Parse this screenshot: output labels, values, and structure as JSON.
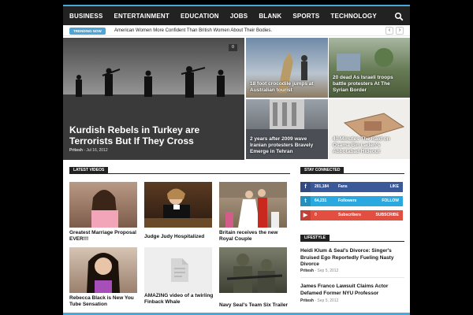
{
  "nav": {
    "items": [
      "BUSINESS",
      "ENTERTAINMENT",
      "EDUCATION",
      "JOBS",
      "BLANK",
      "SPORTS",
      "TECHNOLOGY"
    ],
    "search_icon": "search-icon"
  },
  "trending": {
    "badge": "TRENDING NOW",
    "headline": "American Women More Confident Than British Women About Their Bodies.",
    "prev": "‹",
    "next": "›"
  },
  "hero": {
    "main": {
      "title": "Kurdish Rebels in Turkey are Terrorists But If They Cross",
      "author": "Pritesh",
      "date": "Jul 16, 2012",
      "count": "0"
    },
    "tiles": [
      {
        "caption": "18 foot crocodile jumps at Australian tourist"
      },
      {
        "caption": "20 dead As Israeli troops battle protesters At The Syrian Border"
      },
      {
        "caption": "2 years after 2009 wave Iranian protesters Bravely Emerge in Tehran"
      },
      {
        "caption": "40 Minutes The Raid on Osama Bin Laden's Abbotabad Hideout"
      }
    ]
  },
  "latest_videos": {
    "heading": "LATEST VIDEOS",
    "items": [
      {
        "caption": "Greatest Marriage Proposal EVER!!!"
      },
      {
        "caption": "Judge Judy Hospitalized"
      },
      {
        "caption": "Britain receives the new Royal Couple"
      },
      {
        "caption": "Rebecca Black is New You Tube Sensation"
      },
      {
        "caption": "AMAZING video of a twirling Finback Whale"
      },
      {
        "caption": "Navy Seal's Team Six Trailer"
      }
    ]
  },
  "stay_connected": {
    "heading": "STAY CONNECTED",
    "rows": [
      {
        "icon": "facebook-icon",
        "count": "201,184",
        "label": "Fans",
        "action": "LIKE",
        "color": "#3b5998"
      },
      {
        "icon": "twitter-icon",
        "count": "64,231",
        "label": "Followers",
        "action": "FOLLOW",
        "color": "#2aa9e0"
      },
      {
        "icon": "youtube-icon",
        "count": "0",
        "label": "Subscribers",
        "action": "SUBSCRIBE",
        "color": "#e24e40"
      }
    ]
  },
  "lifestyle": {
    "heading": "LIFESTYLE",
    "posts": [
      {
        "title": "Heidi Klum & Seal's Divorce: Singer's Bruised Ego Reportedly Fueling Nasty Divorce",
        "author": "Pritesh",
        "date": "Sep 5, 2012"
      },
      {
        "title": "James Franco Lawsuit Claims Actor Defamed Former NYU Professor",
        "author": "Pritesh",
        "date": "Sep 5, 2012"
      }
    ]
  }
}
